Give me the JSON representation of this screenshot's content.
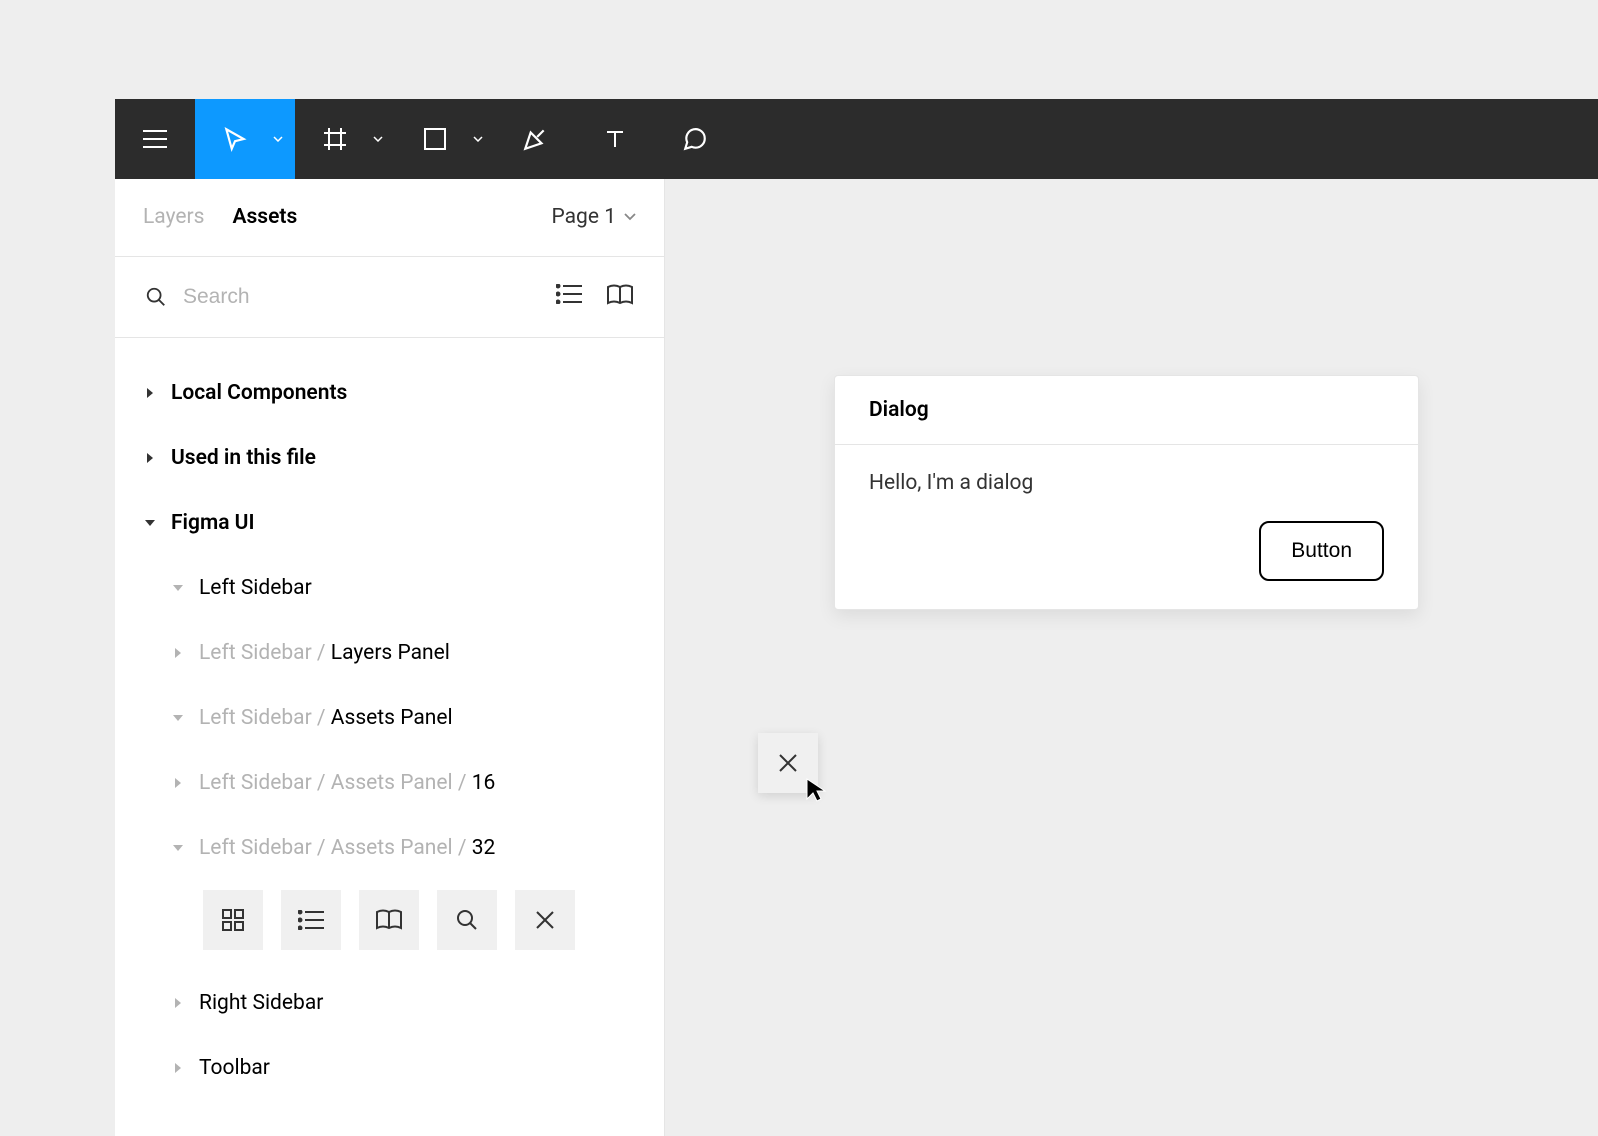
{
  "toolbar": {
    "tools": [
      "menu",
      "move",
      "frame",
      "shape",
      "pen",
      "text",
      "comment"
    ],
    "active_tool": "move"
  },
  "sidebar": {
    "tabs": {
      "layers": "Layers",
      "assets": "Assets",
      "active": "assets"
    },
    "page_label": "Page 1",
    "search_placeholder": "Search",
    "sections": {
      "local_components": "Local Components",
      "used_in_file": "Used in this file",
      "figma_ui": "Figma UI"
    },
    "tree": {
      "left_sidebar": "Left Sidebar",
      "layers_panel": {
        "prefix": "Left Sidebar / ",
        "name": "Layers Panel"
      },
      "assets_panel": {
        "prefix": "Left Sidebar / ",
        "name": "Assets Panel"
      },
      "assets_16": {
        "prefix": "Left Sidebar / Assets Panel / ",
        "name": "16"
      },
      "assets_32": {
        "prefix": "Left Sidebar / Assets Panel / ",
        "name": "32"
      },
      "right_sidebar": "Right Sidebar",
      "toolbar_item": "Toolbar"
    },
    "thumbs": [
      "grid",
      "list",
      "book",
      "search",
      "close"
    ]
  },
  "canvas": {
    "dialog": {
      "title": "Dialog",
      "body": "Hello, I'm a dialog",
      "button": "Button"
    },
    "floating_component": "close-icon"
  }
}
